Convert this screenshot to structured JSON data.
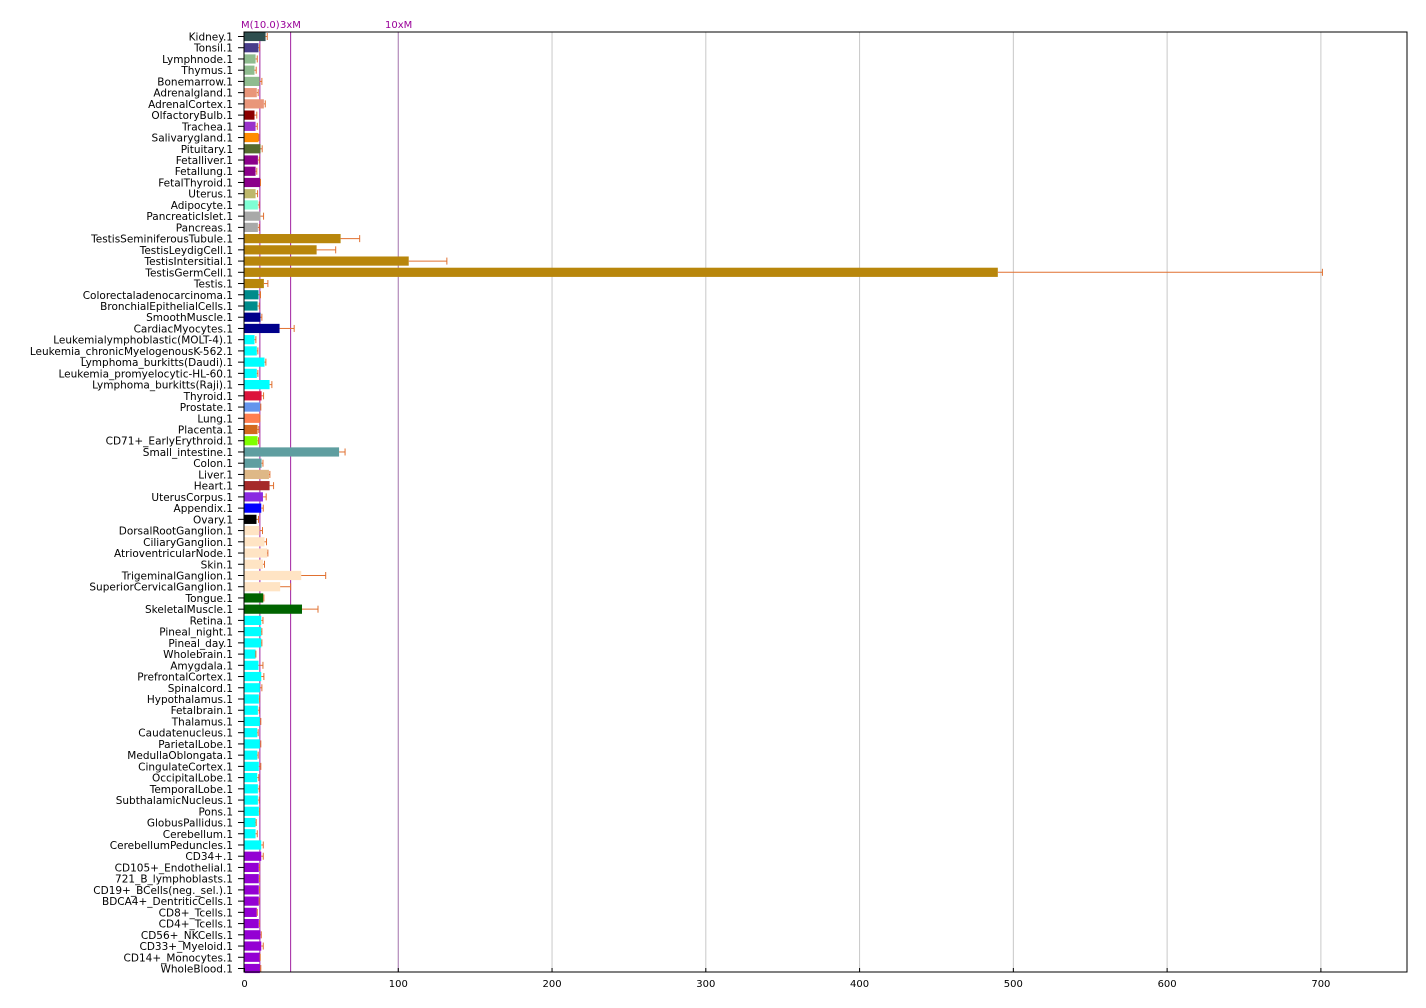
{
  "chart_data": {
    "type": "bar",
    "orientation": "horizontal",
    "xlim": [
      0,
      756
    ],
    "xticks": [
      0,
      100,
      200,
      300,
      400,
      500,
      600,
      700
    ],
    "grid": "vertical",
    "error_bar_color": "#E07030",
    "reference_lines": [
      {
        "label": "M(10.0)",
        "value": 10,
        "color": "#A020A0"
      },
      {
        "label": "3xM",
        "value": 30,
        "color": "#A020A0"
      },
      {
        "label": "10xM",
        "value": 100,
        "color": "#B080B8"
      }
    ],
    "categories": [
      "Kidney.1",
      "Tonsil.1",
      "Lymphnode.1",
      "Thymus.1",
      "Bonemarrow.1",
      "Adrenalgland.1",
      "AdrenalCortex.1",
      "OlfactoryBulb.1",
      "Trachea.1",
      "Salivarygland.1",
      "Pituitary.1",
      "Fetalliver.1",
      "Fetallung.1",
      "FetalThyroid.1",
      "Uterus.1",
      "Adipocyte.1",
      "PancreaticIslet.1",
      "Pancreas.1",
      "TestisSeminiferousTubule.1",
      "TestisLeydigCell.1",
      "TestisIntersitial.1",
      "TestisGermCell.1",
      "Testis.1",
      "Colorectaladenocarcinoma.1",
      "BronchialEpithelialCells.1",
      "SmoothMuscle.1",
      "CardiacMyocytes.1",
      "Leukemialymphoblastic(MOLT-4).1",
      "Leukemia_chronicMyelogenousK-562.1",
      "Lymphoma_burkitts(Daudi).1",
      "Leukemia_promyelocytic-HL-60.1",
      "Lymphoma_burkitts(Raji).1",
      "Thyroid.1",
      "Prostate.1",
      "Lung.1",
      "Placenta.1",
      "CD71+_EarlyErythroid.1",
      "Small_intestine.1",
      "Colon.1",
      "Liver.1",
      "Heart.1",
      "UterusCorpus.1",
      "Appendix.1",
      "Ovary.1",
      "DorsalRootGanglion.1",
      "CiliaryGanglion.1",
      "AtrioventricularNode.1",
      "Skin.1",
      "TrigeminalGanglion.1",
      "SuperiorCervicalGanglion.1",
      "Tongue.1",
      "SkeletalMuscle.1",
      "Retina.1",
      "Pineal_night.1",
      "Pineal_day.1",
      "Wholebrain.1",
      "Amygdala.1",
      "PrefrontalCortex.1",
      "Spinalcord.1",
      "Hypothalamus.1",
      "Fetalbrain.1",
      "Thalamus.1",
      "Caudatenucleus.1",
      "ParietalLobe.1",
      "MedullaOblongata.1",
      "CingulateCortex.1",
      "OccipitalLobe.1",
      "TemporalLobe.1",
      "SubthalamicNucleus.1",
      "Pons.1",
      "GlobusPallidus.1",
      "Cerebellum.1",
      "CerebellumPeduncles.1",
      "CD34+.1",
      "CD105+_Endothelial.1",
      "721_B_lymphoblasts.1",
      "CD19+_BCells(neg._sel.).1",
      "BDCA4+_DentriticCells.1",
      "CD8+_Tcells.1",
      "CD4+_Tcells.1",
      "CD56+_NKCells.1",
      "CD33+_Myeloid.1",
      "CD14+_Monocytes.1",
      "WholeBlood.1"
    ],
    "values": [
      13.7,
      9.1,
      7.2,
      6.5,
      9.8,
      8.0,
      12.6,
      6.5,
      7.2,
      9.1,
      10.4,
      8.7,
      7.2,
      10.2,
      7.2,
      8.7,
      10.4,
      8.7,
      62.5,
      46.9,
      106.8,
      489.9,
      12.6,
      9.1,
      8.5,
      10.4,
      22.8,
      6.5,
      8.0,
      13.0,
      8.0,
      16.3,
      11.1,
      10.2,
      10.0,
      8.5,
      8.5,
      61.5,
      11.1,
      15.9,
      16.3,
      12.0,
      10.9,
      7.8,
      9.8,
      13.0,
      14.7,
      12.0,
      36.9,
      23.2,
      12.2,
      37.4,
      10.9,
      10.9,
      10.9,
      7.2,
      9.1,
      10.9,
      10.0,
      9.3,
      8.7,
      10.0,
      8.3,
      10.0,
      8.3,
      9.3,
      8.3,
      8.7,
      8.7,
      9.3,
      7.2,
      7.2,
      10.9,
      10.9,
      9.3,
      9.3,
      9.3,
      9.3,
      8.0,
      9.3,
      10.4,
      10.9,
      10.0,
      10.0
    ],
    "error_upper": [
      14.8,
      9.8,
      8.3,
      7.6,
      11.3,
      8.9,
      13.5,
      8.0,
      8.3,
      9.3,
      11.5,
      9.6,
      8.0,
      10.4,
      8.5,
      9.6,
      12.4,
      9.6,
      74.9,
      59.3,
      131.6,
      701.0,
      15.2,
      10.4,
      9.6,
      11.3,
      32.3,
      7.4,
      8.7,
      13.9,
      8.7,
      17.8,
      12.4,
      10.6,
      10.0,
      9.3,
      9.1,
      65.4,
      12.0,
      16.5,
      18.9,
      14.1,
      12.2,
      9.1,
      11.7,
      14.3,
      15.2,
      13.0,
      52.8,
      30.0,
      12.6,
      47.8,
      12.0,
      11.3,
      11.3,
      7.4,
      12.0,
      12.6,
      11.3,
      9.8,
      9.6,
      10.6,
      8.9,
      10.6,
      8.9,
      10.6,
      9.3,
      9.6,
      9.6,
      9.8,
      7.6,
      8.3,
      12.2,
      12.2,
      9.8,
      9.8,
      9.8,
      9.6,
      8.3,
      9.8,
      10.9,
      12.2,
      10.2,
      10.6
    ],
    "colors": [
      "#2F4F4F",
      "#483D8B",
      "#8FBC8F",
      "#8FBC8F",
      "#8FBC8F",
      "#E9967A",
      "#E9967A",
      "#8B0000",
      "#9932CC",
      "#FF8C00",
      "#556B2F",
      "#8B008B",
      "#8B008B",
      "#8B008B",
      "#BDB76B",
      "#7FFFD4",
      "#A9A9A9",
      "#A9A9A9",
      "#B8860B",
      "#B8860B",
      "#B8860B",
      "#B8860B",
      "#B8860B",
      "#008B8B",
      "#008B8B",
      "#00008B",
      "#00008B",
      "#00FFFF",
      "#00FFFF",
      "#00FFFF",
      "#00FFFF",
      "#00FFFF",
      "#DC143C",
      "#6495ED",
      "#FF7F50",
      "#D2691E",
      "#7FFF00",
      "#5F9EA0",
      "#5F9EA0",
      "#DEB887",
      "#A52A2A",
      "#8A2BE2",
      "#0000FF",
      "#000000",
      "#FFE4C4",
      "#FFE4C4",
      "#FFE4C4",
      "#FFE4C4",
      "#FFE4C4",
      "#FFE4C4",
      "#006400",
      "#006400",
      "#00FFFF",
      "#00FFFF",
      "#00FFFF",
      "#00FFFF",
      "#00FFFF",
      "#00FFFF",
      "#00FFFF",
      "#00FFFF",
      "#00FFFF",
      "#00FFFF",
      "#00FFFF",
      "#00FFFF",
      "#00FFFF",
      "#00FFFF",
      "#00FFFF",
      "#00FFFF",
      "#00FFFF",
      "#00FFFF",
      "#00FFFF",
      "#00FFFF",
      "#00FFFF",
      "#9400D3",
      "#9400D3",
      "#9400D3",
      "#9400D3",
      "#9400D3",
      "#9400D3",
      "#9400D3",
      "#9400D3",
      "#9400D3",
      "#9400D3",
      "#9400D3"
    ]
  }
}
